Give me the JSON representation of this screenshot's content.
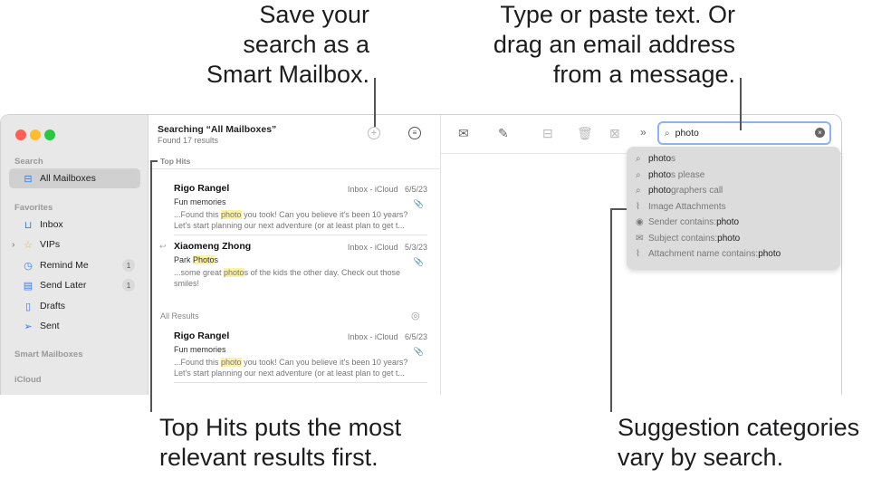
{
  "callouts": {
    "save": [
      "Save your",
      "search as a",
      "Smart Mailbox."
    ],
    "type": [
      "Type or paste text. Or",
      "drag an email address",
      "from a message."
    ],
    "tophits": [
      "Top Hits puts the most",
      "relevant results first."
    ],
    "suggest": [
      "Suggestion categories",
      "vary by search."
    ]
  },
  "sidebar": {
    "search_header": "Search",
    "all_mailboxes": "All Mailboxes",
    "favorites_header": "Favorites",
    "items": [
      {
        "label": "Inbox",
        "icon": "tray-icon"
      },
      {
        "label": "VIPs",
        "icon": "star-icon"
      },
      {
        "label": "Remind Me",
        "icon": "clock-icon",
        "badge": "1"
      },
      {
        "label": "Send Later",
        "icon": "calendar-icon",
        "badge": "1"
      },
      {
        "label": "Drafts",
        "icon": "doc-icon"
      },
      {
        "label": "Sent",
        "icon": "paperplane-icon"
      }
    ],
    "smart_header": "Smart Mailboxes",
    "icloud_header": "iCloud"
  },
  "list": {
    "title": "Searching “All Mailboxes”",
    "subtitle": "Found 17 results",
    "top_hits": "Top Hits",
    "all_results": "All Results",
    "messages": [
      {
        "from": "Rigo Rangel",
        "mailbox": "Inbox - iCloud",
        "date": "6/5/23",
        "subject": "Fun memories",
        "p1": "...Found this ",
        "p1h": "photo",
        "p1b": " you took! Can you believe it's been 10 years?",
        "p2": "Let's start planning our next adventure (or at least plan to get t..."
      },
      {
        "from": "Xiaomeng Zhong",
        "mailbox": "Inbox - iCloud",
        "date": "5/3/23",
        "subject": "Park ",
        "subjh": "Photo",
        "subjb": "s",
        "p1": "...some great ",
        "p1h": "photo",
        "p1b": "s of the kids the other day. Check out those",
        "p2": "smiles!"
      },
      {
        "from": "Rigo Rangel",
        "mailbox": "Inbox - iCloud",
        "date": "6/5/23",
        "subject": "Fun memories",
        "p1": "...Found this ",
        "p1h": "photo",
        "p1b": " you took! Can you believe it's been 10 years?",
        "p2": "Let's start planning our next adventure (or at least plan to get t..."
      }
    ]
  },
  "search": {
    "value": "photo"
  },
  "suggestions": [
    {
      "icon": "search-icon",
      "bold": "photo",
      "rest": "s"
    },
    {
      "icon": "search-icon",
      "bold": "photo",
      "rest": "s please"
    },
    {
      "icon": "search-icon",
      "bold": "photo",
      "rest": "graphers call"
    },
    {
      "icon": "paperclip-icon",
      "rest": "Image Attachments",
      "bold": ""
    },
    {
      "icon": "person-icon",
      "rest": "Sender contains: ",
      "bold2": "photo"
    },
    {
      "icon": "envelope-icon",
      "rest": "Subject contains: ",
      "bold2": "photo"
    },
    {
      "icon": "paperclip-icon",
      "rest": "Attachment name contains: ",
      "bold2": "photo"
    }
  ]
}
